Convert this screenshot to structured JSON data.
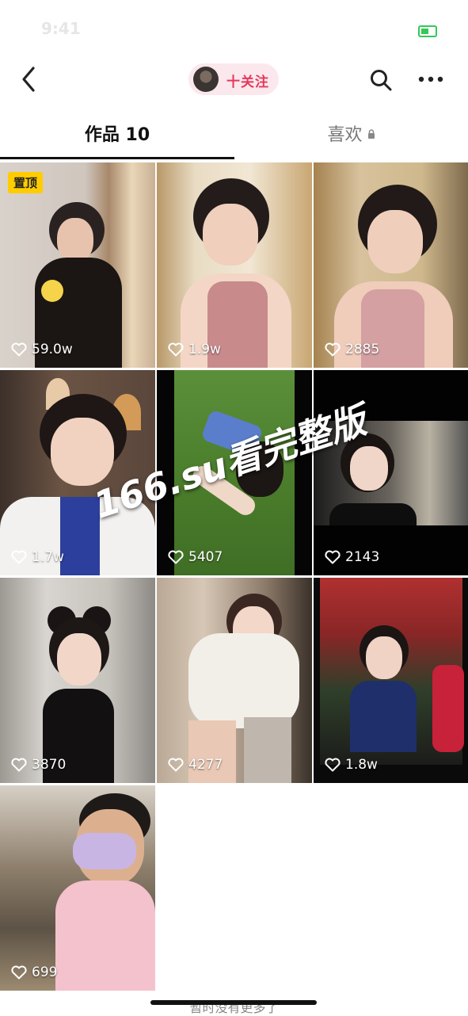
{
  "status_bar": {
    "time": "9:41"
  },
  "nav": {
    "follow_label": "十关注"
  },
  "tabs": [
    {
      "label": "作品 10"
    },
    {
      "label": "喜欢"
    }
  ],
  "grid": {
    "pinned_label": "置顶",
    "items": [
      {
        "likes": "59.0w"
      },
      {
        "likes": "1.9w"
      },
      {
        "likes": "2885"
      },
      {
        "likes": "1.7w"
      },
      {
        "likes": "5407"
      },
      {
        "likes": "2143"
      },
      {
        "likes": "3870"
      },
      {
        "likes": "4277"
      },
      {
        "likes": "1.8w"
      },
      {
        "likes": "699"
      }
    ]
  },
  "watermark": "166.su看完整版",
  "footer": "暂时没有更多了",
  "icons": {
    "back": "chevron-left-icon",
    "search": "search-icon",
    "more": "more-icon",
    "heart": "heart-icon",
    "lock": "lock-icon"
  }
}
